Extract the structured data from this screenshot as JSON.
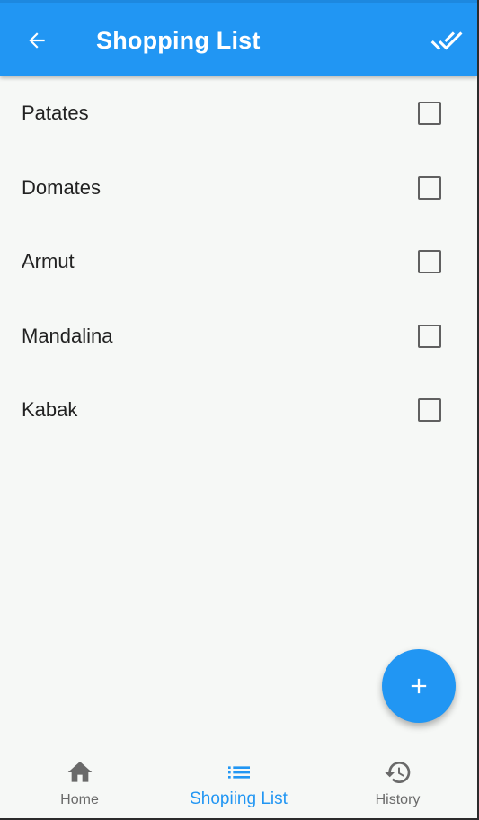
{
  "appbar": {
    "title": "Shopping List",
    "back_icon": "arrow-back-icon",
    "action_icon": "done-all-icon",
    "color": "#2196f3"
  },
  "items": [
    {
      "label": "Patates",
      "checked": false
    },
    {
      "label": "Domates",
      "checked": false
    },
    {
      "label": "Armut",
      "checked": false
    },
    {
      "label": "Mandalina",
      "checked": false
    },
    {
      "label": "Kabak",
      "checked": false
    }
  ],
  "fab": {
    "icon": "add-icon"
  },
  "bottom_nav": {
    "items": [
      {
        "label": "Home",
        "icon": "home-icon",
        "active": false
      },
      {
        "label": "Shopiing List",
        "icon": "list-icon",
        "active": true
      },
      {
        "label": "History",
        "icon": "history-icon",
        "active": false
      }
    ],
    "active_color": "#2196f3",
    "inactive_color": "#6a6a6a"
  }
}
